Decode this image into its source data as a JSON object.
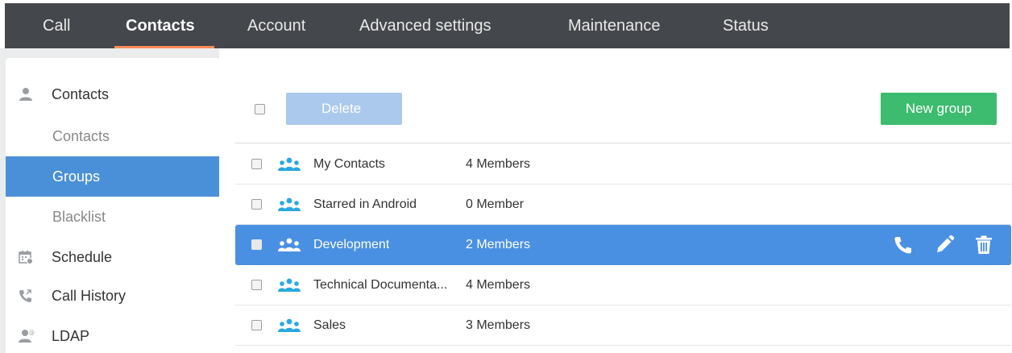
{
  "topnav": {
    "tabs": [
      {
        "label": "Call"
      },
      {
        "label": "Contacts"
      },
      {
        "label": "Account"
      },
      {
        "label": "Advanced settings"
      },
      {
        "label": "Maintenance"
      },
      {
        "label": "Status"
      }
    ],
    "active_tab": "Contacts",
    "accent_color": "#ff8a57"
  },
  "sidebar": {
    "sections": [
      {
        "label": "Contacts",
        "icon": "person-icon"
      },
      {
        "label": "Schedule",
        "icon": "calendar-icon"
      },
      {
        "label": "Call History",
        "icon": "call-history-icon"
      },
      {
        "label": "LDAP",
        "icon": "ldap-person-icon"
      }
    ],
    "contacts_sub": [
      {
        "label": "Contacts"
      },
      {
        "label": "Groups"
      },
      {
        "label": "Blacklist"
      }
    ],
    "active_item": "Groups",
    "active_color": "#4a90d9"
  },
  "toolbar": {
    "delete_label": "Delete",
    "new_group_label": "New group",
    "new_group_color": "#3dbb6e"
  },
  "groups": [
    {
      "name": "My Contacts",
      "members": "4 Members",
      "selected": false
    },
    {
      "name": "Starred in Android",
      "members": "0 Member",
      "selected": false
    },
    {
      "name": "Development",
      "members": "2 Members",
      "selected": true
    },
    {
      "name": "Technical Documenta...",
      "members": "4 Members",
      "selected": false
    },
    {
      "name": "Sales",
      "members": "3 Members",
      "selected": false
    }
  ],
  "row_actions": {
    "icons": [
      "phone-icon",
      "edit-pencil-icon",
      "trash-icon"
    ]
  },
  "group_icon_color": "#29a8df"
}
